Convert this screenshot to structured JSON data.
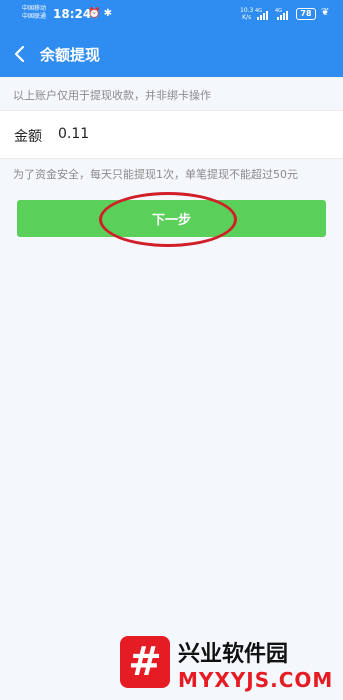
{
  "status_bar": {
    "carrier_1": "中国移动",
    "carrier_2": "中国联通",
    "time": "18:24",
    "net_speed_value": "10.3",
    "net_speed_unit": "K/s",
    "network_1": "4G",
    "network_2": "4G",
    "battery": "78",
    "color": "#2f8df1"
  },
  "nav": {
    "title": "余额提现",
    "back_icon": "chevron-left-icon"
  },
  "notice": "以上账户仅用于提现收款，并非绑卡操作",
  "amount": {
    "label": "金额",
    "value": "0.11"
  },
  "limit_note": "为了资金安全，每天只能提现1次，单笔提现不能超过50元",
  "next_button": {
    "label": "下一步",
    "color": "#5ad05a"
  },
  "annotation": {
    "color": "#d11f27"
  },
  "watermark": {
    "logo_char": "#",
    "name": "兴业软件园",
    "url": "MYXYJS.COM",
    "color": "#e51c23"
  }
}
